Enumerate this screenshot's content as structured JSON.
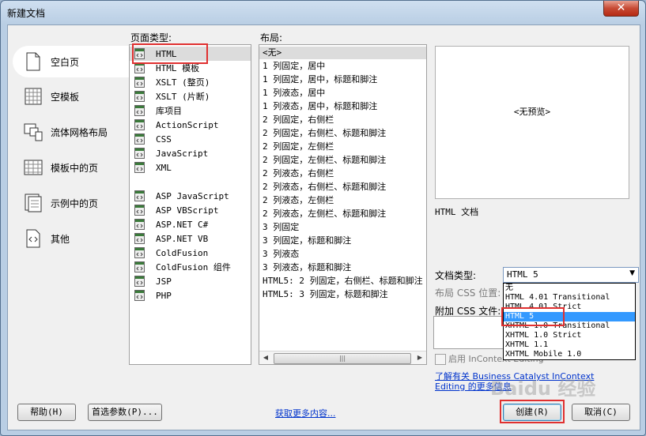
{
  "window": {
    "title": "新建文档",
    "close_glyph": "✕"
  },
  "categories": [
    {
      "label": "空白页",
      "icon": "blank-page-icon",
      "selected": true
    },
    {
      "label": "空模板",
      "icon": "blank-template-icon"
    },
    {
      "label": "流体网格布局",
      "icon": "fluid-grid-icon"
    },
    {
      "label": "模板中的页",
      "icon": "template-page-icon"
    },
    {
      "label": "示例中的页",
      "icon": "sample-page-icon"
    },
    {
      "label": "其他",
      "icon": "other-icon"
    }
  ],
  "page_type": {
    "label": "页面类型:",
    "items": [
      "HTML",
      "HTML 模板",
      "XSLT (整页)",
      "XSLT (片断)",
      "库项目",
      "ActionScript",
      "CSS",
      "JavaScript",
      "XML",
      "ASP JavaScript",
      "ASP VBScript",
      "ASP.NET C#",
      "ASP.NET VB",
      "ColdFusion",
      "ColdFusion 组件",
      "JSP",
      "PHP"
    ],
    "selected": "HTML"
  },
  "layout": {
    "label": "布局:",
    "items": [
      "<无>",
      "1 列固定，居中",
      "1 列固定，居中，标题和脚注",
      "1 列液态，居中",
      "1 列液态，居中，标题和脚注",
      "2 列固定，右侧栏",
      "2 列固定，右侧栏、标题和脚注",
      "2 列固定，左侧栏",
      "2 列固定，左侧栏、标题和脚注",
      "2 列液态，右侧栏",
      "2 列液态，右侧栏、标题和脚注",
      "2 列液态，左侧栏",
      "2 列液态，左侧栏、标题和脚注",
      "3 列固定",
      "3 列固定，标题和脚注",
      "3 列液态",
      "3 列液态，标题和脚注",
      "HTML5: 2 列固定，右侧栏、标题和脚注",
      "HTML5: 3 列固定，标题和脚注"
    ],
    "selected": "<无>"
  },
  "preview": {
    "text": "<无预览>",
    "description": "HTML 文档"
  },
  "doctype": {
    "label": "文档类型:",
    "value": "HTML 5",
    "options": [
      "无",
      "HTML 4.01 Transitional",
      "HTML 4.01 Strict",
      "HTML 5",
      "XHTML 1.0 Transitional",
      "XHTML 1.0 Strict",
      "XHTML 1.1",
      "XHTML Mobile 1.0"
    ]
  },
  "layout_css_label": "布局 CSS 位置:",
  "attach_css_label": "附加 CSS 文件:",
  "incontext_label": "启用 InContext Editing",
  "bc_link": {
    "line1": "了解有关 Business Catalyst InContext",
    "line2": "Editing 的更多信息"
  },
  "buttons": {
    "help": "帮助(H)",
    "prefs": "首选参数(P)...",
    "create": "创建(R)",
    "cancel": "取消(C)"
  },
  "more_content_link": "获取更多内容...",
  "watermark": "Baidu 经验"
}
